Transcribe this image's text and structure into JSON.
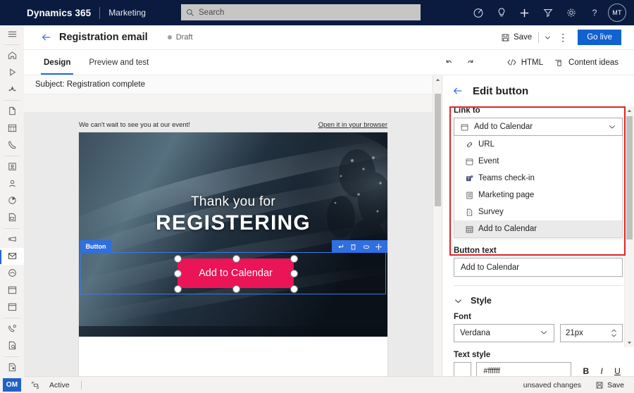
{
  "topnav": {
    "brand": "Dynamics 365",
    "app_name": "Marketing",
    "search_placeholder": "Search",
    "search_value": "",
    "icons": [
      "goal-icon",
      "lightbulb-icon",
      "plus-icon",
      "filter-icon",
      "gear-icon",
      "help-icon"
    ],
    "avatar_initials": "MT",
    "bg_color": "#0b1b40"
  },
  "rail": {
    "items": [
      {
        "name": "hamburger-menu-icon"
      },
      {
        "name": "home-icon"
      },
      {
        "name": "recent-icon"
      },
      {
        "name": "pinned-icon"
      },
      {
        "name": "page-icon"
      },
      {
        "name": "calendar-icon"
      },
      {
        "name": "phone-icon"
      },
      {
        "name": "contacts-icon"
      },
      {
        "name": "person-icon"
      },
      {
        "name": "chart-icon"
      },
      {
        "name": "report-icon"
      },
      {
        "name": "megaphone-icon"
      },
      {
        "name": "email-icon"
      },
      {
        "name": "customer-journey-icon"
      },
      {
        "name": "event-calendar-icon"
      },
      {
        "name": "calendar-alt-icon"
      },
      {
        "name": "phone-settings-icon"
      },
      {
        "name": "page-search-icon"
      },
      {
        "name": "form-icon"
      },
      {
        "name": "tag-icon"
      }
    ],
    "selected_index": 12,
    "badge": "OM"
  },
  "command_bar": {
    "back": "back-arrow-icon",
    "title": "Registration email",
    "status": "Draft",
    "save_label": "Save",
    "more_label": "⋮",
    "go_live_label": "Go live",
    "go_live_color": "#0f62d0"
  },
  "tabs": {
    "items": [
      {
        "label": "Design",
        "active": true
      },
      {
        "label": "Preview and test",
        "active": false
      }
    ],
    "undo": "undo-icon",
    "redo": "redo-icon",
    "html_label": "HTML",
    "content_ideas_label": "Content ideas"
  },
  "canvas": {
    "subject_label": "Subject: Registration complete",
    "preheader_text": "We can't wait to see you at our event!",
    "browser_link": "Open it in your browser",
    "hero_line1": "Thank you for",
    "hero_line2": "REGISTERING",
    "widget_tag": "Button",
    "widget_tools": [
      "move-up-icon",
      "delete-icon",
      "duplicate-icon",
      "drag-move-icon"
    ],
    "cta_label": "Add to Calendar",
    "cta_color": "#ea1456"
  },
  "right_panel": {
    "back_icon": "back-arrow-icon",
    "title": "Edit button",
    "link_to_label": "Link to",
    "link_to_value": "Add to Calendar",
    "link_to_icon": "calendar-icon",
    "dropdown_options": [
      {
        "label": "URL",
        "icon": "link-icon",
        "selected": false
      },
      {
        "label": "Event",
        "icon": "calendar-icon",
        "selected": false
      },
      {
        "label": "Teams check-in",
        "icon": "teams-icon",
        "selected": false
      },
      {
        "label": "Marketing page",
        "icon": "page-icon",
        "selected": false
      },
      {
        "label": "Survey",
        "icon": "survey-icon",
        "selected": false
      },
      {
        "label": "Add to Calendar",
        "icon": "calendar-grid-icon",
        "selected": true
      }
    ],
    "highlight_color": "#e02424",
    "button_text_label": "Button text",
    "button_text_value": "Add to Calendar",
    "style_section_label": "Style",
    "font_label": "Font",
    "font_value": "Verdana",
    "font_size_value": "21px",
    "text_style_label": "Text style",
    "text_color_value": "#ffffff",
    "bold_label": "B",
    "italic_label": "I",
    "underline_label": "U"
  },
  "status_bar": {
    "icon": "resize-icon",
    "state_label": "Active",
    "unsaved_label": "unsaved changes",
    "save_label": "Save"
  }
}
